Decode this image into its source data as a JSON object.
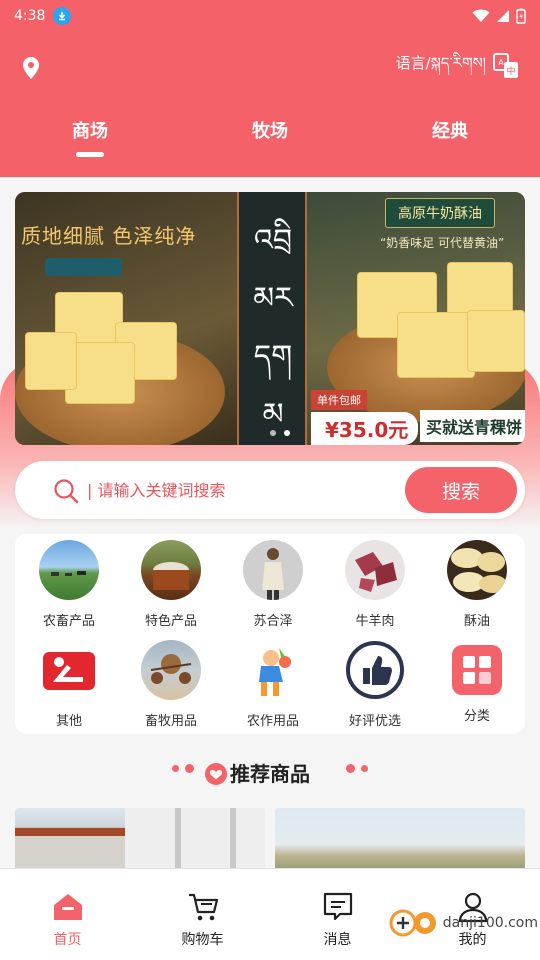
{
  "status_bar": {
    "time": "4:38"
  },
  "header": {
    "language_label": "语言/སྐད་རིགས།",
    "tabs": [
      {
        "label": "商场",
        "active": true
      },
      {
        "label": "牧场",
        "active": false
      },
      {
        "label": "经典",
        "active": false
      }
    ]
  },
  "banner": {
    "headline": "质地细腻 色泽纯净",
    "tibetan_text": [
      "འབྲི",
      "མར",
      "དག",
      "མ"
    ],
    "product_title": "高原牛奶酥油",
    "product_sub": "“奶香味足 可代替黄油”",
    "shipping_tag": "单件包邮",
    "price": "¥35.0元",
    "promo": "买就送青稞饼",
    "page_count": 2,
    "current_page": 2
  },
  "search": {
    "placeholder": "| 请输入关键词搜索",
    "button_label": "搜索"
  },
  "categories": [
    {
      "label": "农畜产品",
      "icon": "pasture-photo-icon"
    },
    {
      "label": "特色产品",
      "icon": "specialty-photo-icon"
    },
    {
      "label": "苏合泽",
      "icon": "person-photo-icon"
    },
    {
      "label": "牛羊肉",
      "icon": "meat-photo-icon"
    },
    {
      "label": "酥油",
      "icon": "butter-photo-icon"
    },
    {
      "label": "其他",
      "icon": "other-icon"
    },
    {
      "label": "畜牧用品",
      "icon": "livestock-supplies-icon"
    },
    {
      "label": "农作用品",
      "icon": "farming-supplies-icon"
    },
    {
      "label": "好评优选",
      "icon": "thumbs-up-icon"
    },
    {
      "label": "分类",
      "icon": "category-grid-icon"
    }
  ],
  "recommend": {
    "title": "推荐商品"
  },
  "bottom_nav": [
    {
      "label": "首页",
      "icon": "home-icon",
      "active": true
    },
    {
      "label": "购物车",
      "icon": "cart-icon",
      "active": false
    },
    {
      "label": "消息",
      "icon": "message-icon",
      "active": false
    },
    {
      "label": "我的",
      "icon": "user-icon",
      "active": false
    }
  ],
  "watermark": "danji100.com",
  "colors": {
    "accent": "#f4636a",
    "header_bg": "#f46168"
  }
}
